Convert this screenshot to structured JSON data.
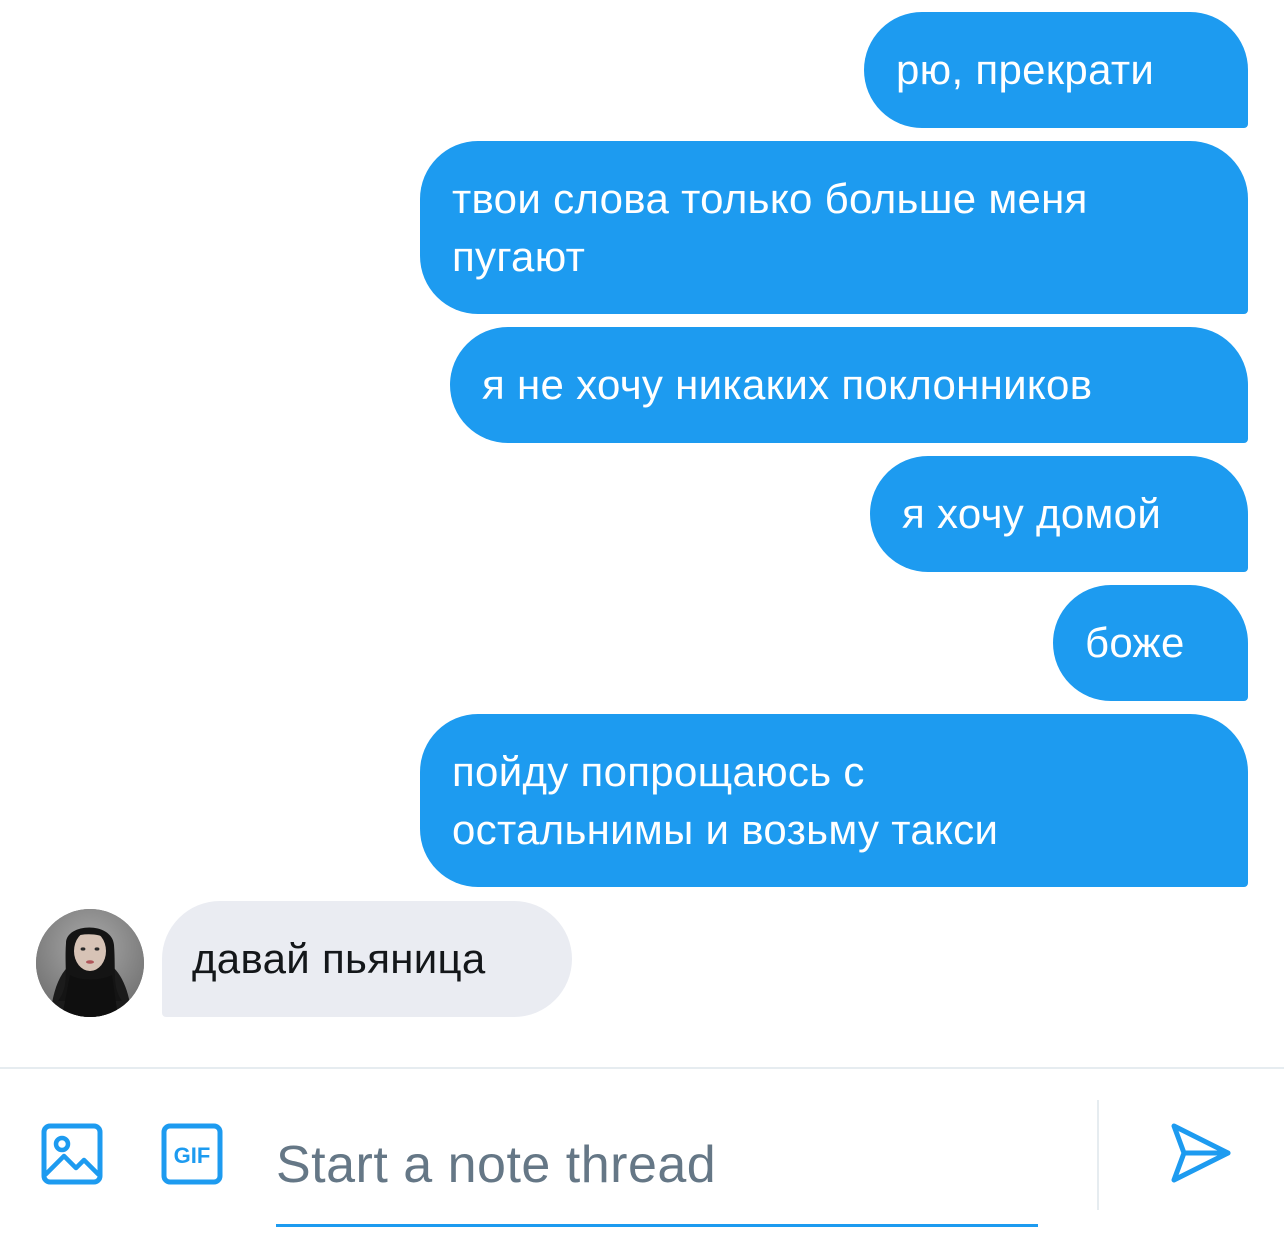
{
  "colors": {
    "accent": "#1d9bf0",
    "incoming_bubble": "#eaecf2",
    "border": "#e6ecf0",
    "placeholder": "#657786"
  },
  "messages": [
    {
      "direction": "outgoing",
      "lines": [
        "рю, прекрати"
      ]
    },
    {
      "direction": "outgoing",
      "lines": [
        "твои слова только больше меня",
        "пугают"
      ]
    },
    {
      "direction": "outgoing",
      "lines": [
        "я не хочу никаких поклонников"
      ]
    },
    {
      "direction": "outgoing",
      "lines": [
        "я хочу домой"
      ]
    },
    {
      "direction": "outgoing",
      "lines": [
        "боже"
      ]
    },
    {
      "direction": "outgoing",
      "lines": [
        "пойду попрощаюсь с",
        "остальнимы и возьму такси"
      ]
    },
    {
      "direction": "incoming",
      "lines": [
        "давай пьяница"
      ]
    }
  ],
  "composer": {
    "media_icon": "image-icon",
    "gif_icon": "gif-icon",
    "gif_label": "GIF",
    "placeholder": "Start a note thread",
    "value": "",
    "send_icon": "send-icon"
  }
}
